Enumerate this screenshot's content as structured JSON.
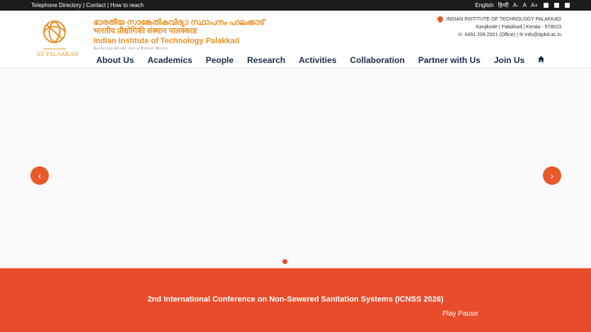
{
  "topbar": {
    "left_links": [
      "Telephone Directory",
      "Contact",
      "How to reach"
    ],
    "separator": "|",
    "lang_en": "English",
    "lang_hi": "हिन्दी",
    "font_small": "A-",
    "font_normal": "A",
    "font_large": "A+",
    "social_icons": [
      "twitter-icon",
      "linkedin-icon",
      "youtube-icon"
    ]
  },
  "header": {
    "name_ml": "ഭാരതീയ സാങ്കേതികവിദ്യാ സ്ഥാപനം പാലക്കാട്",
    "name_hi": "भारतीय प्रौद्योगिकी संस्थान पालक्काड",
    "name_en": "Indian Institute of Technology Palakkad",
    "tagline": "Nurturing Minds For a Better World",
    "logo_text": "IIT PALAKKAD",
    "address_line1": "INDIAN INSTITUTE OF TECHNOLOGY PALAKKAD",
    "address_line2": "Kanjikode | Palakkad | Kerala - 678623",
    "phone": "0491 209 2001 (Office)",
    "email": "info@iitpkd.ac.in"
  },
  "nav": {
    "items": [
      "About Us",
      "Academics",
      "People",
      "Research",
      "Activities",
      "Collaboration",
      "Partner with Us",
      "Join Us"
    ]
  },
  "slider": {
    "prev_label": "‹",
    "next_label": "›"
  },
  "banner": {
    "title": "2nd International Conference on Non-Sewered Sanitation Systems (ICNSS 2026)",
    "play": "Play",
    "pause": "Pause"
  },
  "colors": {
    "accent": "#e84c2a",
    "brand_orange": "#e8922a",
    "nav_text": "#1c2b4a",
    "topbar_bg": "#1c1c1c"
  }
}
